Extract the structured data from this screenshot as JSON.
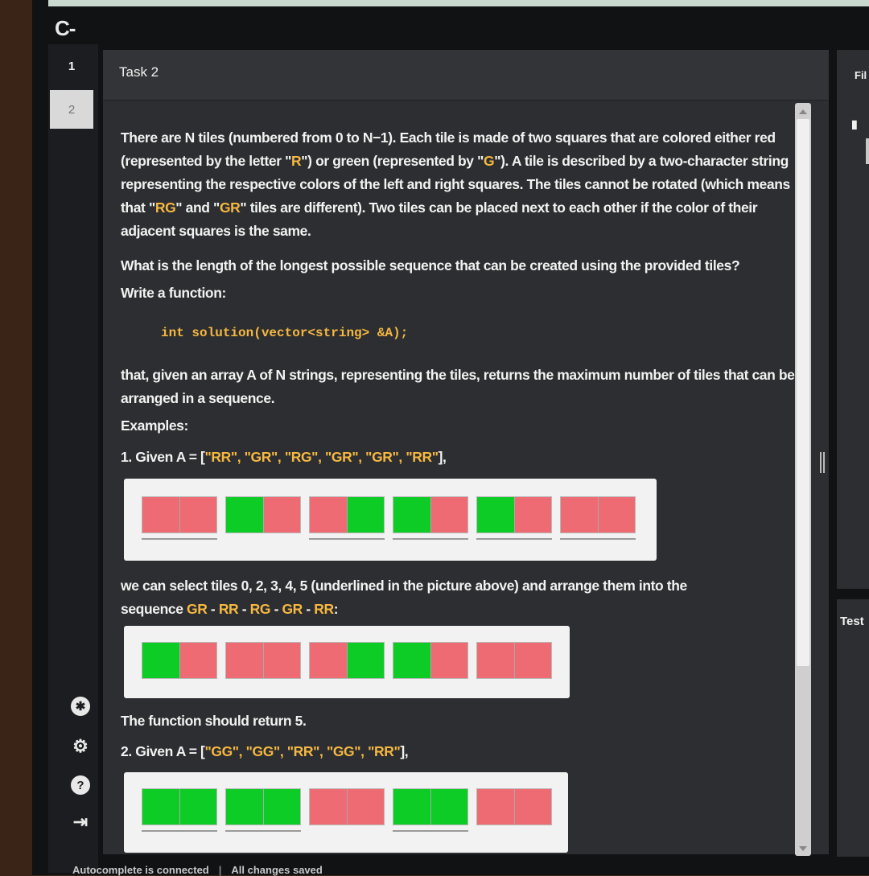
{
  "app": {
    "logo": "C-"
  },
  "tasks": [
    {
      "number": "1"
    },
    {
      "number": "2"
    }
  ],
  "panel": {
    "title": "Task 2"
  },
  "problem": {
    "p1_a": "There are N tiles (numbered from 0 to N−1). Each tile is made of two squares that are colored either red (represented by the letter \"",
    "p1_r": "R",
    "p1_b": "\") or green (represented by \"",
    "p1_g": "G",
    "p1_c": "\"). A tile is described by a two-character string representing the respective colors of the left and right squares. The tiles cannot be rotated (which means that \"",
    "p1_rg": "RG",
    "p1_d": "\" and \"",
    "p1_gr": "GR",
    "p1_e": "\" tiles are different). Two tiles can be placed next to each other if the color of their adjacent squares is the same.",
    "question": "What is the length of the longest possible sequence that can be created using the provided tiles?",
    "write_fn": "Write a function:",
    "signature": "int solution(vector<string> &A);",
    "given": "that, given an array A of N strings, representing the tiles, returns the maximum number of tiles that can be arranged in a sequence.",
    "examples_label": "Examples:",
    "ex1_prefix": "1. Given A = [",
    "ex1_items": "\"RR\", \"GR\", \"RG\", \"GR\", \"GR\", \"RR\"",
    "ex1_suffix": "],",
    "ex1_explain": "we can select tiles 0, 2, 3, 4, 5 (underlined in the picture above) and arrange them into the",
    "ex1_seq_prefix": "sequence ",
    "ex1_seq": [
      "GR",
      "RR",
      "RG",
      "GR",
      "RR"
    ],
    "ex1_seq_sep": " - ",
    "ex1_seq_suffix": ":",
    "ex1_return": "The function should return 5.",
    "ex2_prefix": "2. Given A = [",
    "ex2_items": "\"GG\", \"GG\", \"RR\", \"GG\", \"RR\"",
    "ex2_suffix": "],"
  },
  "tiles": {
    "example1": [
      "RR",
      "GR",
      "RG",
      "GR",
      "GR",
      "RR"
    ],
    "example1_underlined": [
      0,
      2,
      3,
      4,
      5
    ],
    "arrangement1": [
      "GR",
      "RR",
      "RG",
      "GR",
      "RR"
    ],
    "example2": [
      "GG",
      "GG",
      "RR",
      "GG",
      "RR"
    ],
    "example2_underlined": [
      0,
      1,
      3
    ]
  },
  "colors": {
    "red": "#ef6b74",
    "green": "#0ecc26",
    "highlight": "#f5b841"
  },
  "right_panel": {
    "top_label": "Fil",
    "test_label": "Test"
  },
  "status": {
    "autocomplete": "Autocomplete is connected",
    "saved": "All changes saved"
  },
  "icons": [
    "plugin-icon",
    "gear-icon",
    "help-icon",
    "logout-icon"
  ]
}
